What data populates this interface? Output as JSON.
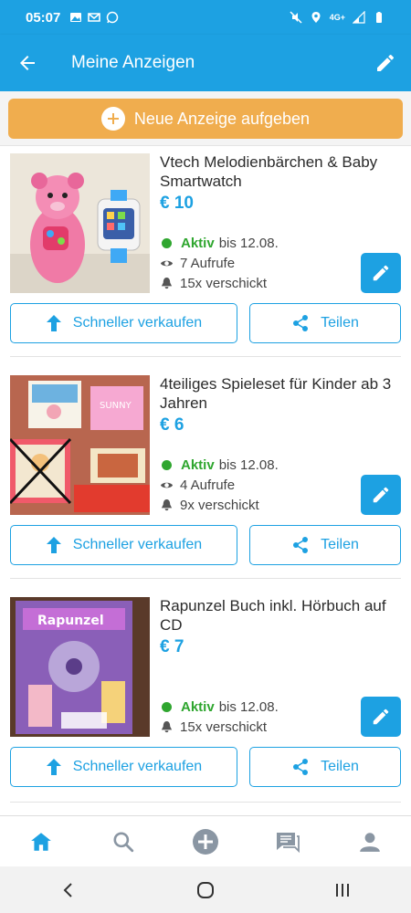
{
  "status_bar": {
    "time": "05:07",
    "network_label": "4G+"
  },
  "app_bar": {
    "title": "Meine Anzeigen"
  },
  "new_ad_button": {
    "label": "Neue Anzeige aufgeben"
  },
  "colors": {
    "brand": "#1da1e2",
    "accent_orange": "#f0ad4e",
    "active_green": "#2fa62f"
  },
  "listings": [
    {
      "title": "Vtech Melodienbärchen & Baby Smartwatch",
      "price": "€ 10",
      "status": "Aktiv",
      "status_until": "bis 12.08.",
      "views": "7 Aufrufe",
      "sent": "15x verschickt",
      "sell_label": "Schneller verkaufen",
      "share_label": "Teilen",
      "image": "pink-bear-toy-photo"
    },
    {
      "title": "4teiliges Spieleset für Kinder ab 3 Jahren",
      "price": "€ 6",
      "status": "Aktiv",
      "status_until": "bis 12.08.",
      "views": "4 Aufrufe",
      "sent": "9x verschickt",
      "sell_label": "Schneller verkaufen",
      "share_label": "Teilen",
      "image": "board-games-photo"
    },
    {
      "title": "Rapunzel Buch inkl. Hörbuch auf CD",
      "price": "€ 7",
      "status": "Aktiv",
      "status_until": "bis 12.08.",
      "sent": "15x verschickt",
      "sell_label": "Schneller verkaufen",
      "share_label": "Teilen",
      "image": "rapunzel-book-photo",
      "cover_title": "Rapunzel"
    }
  ],
  "bottom_nav": {
    "items": [
      {
        "icon": "home-icon",
        "active": true
      },
      {
        "icon": "search-icon",
        "active": false
      },
      {
        "icon": "add-icon",
        "active": false
      },
      {
        "icon": "messages-icon",
        "active": false
      },
      {
        "icon": "profile-icon",
        "active": false
      }
    ]
  },
  "system_nav": {
    "icons": [
      "back-icon",
      "home-circle-icon",
      "recents-icon"
    ]
  }
}
